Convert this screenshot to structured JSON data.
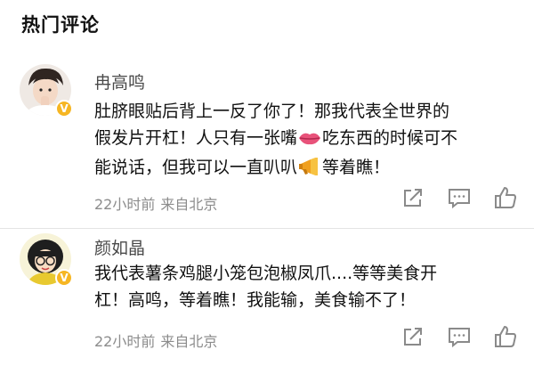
{
  "section": {
    "title": "热门评论"
  },
  "comments": [
    {
      "username": "冉高鸣",
      "line1": "肚脐眼贴后背上一反了你了！那我代表全世界的",
      "line2_a": "假发片开杠！人只有一张嘴",
      "line2_b": "吃东西的时候可不",
      "line3_a": "能说话，但我可以一直叭叭",
      "line3_b": "等着瞧！",
      "time": "22小时前",
      "location": "来自北京",
      "emojis": [
        "lips-emoji",
        "megaphone-emoji"
      ],
      "icons": [
        "share-icon",
        "comment-icon",
        "like-icon"
      ]
    },
    {
      "username": "颜如晶",
      "line1": "我代表薯条鸡腿小笼包泡椒凤爪....等等美食开",
      "line2": "杠！高鸣，等着瞧！我能输，美食输不了！",
      "time": "22小时前",
      "location": "来自北京",
      "icons": [
        "share-icon",
        "comment-icon",
        "like-icon"
      ]
    }
  ],
  "colors": {
    "text": "#111111",
    "meta": "#8c8c8c",
    "username": "#4a4a4a",
    "verified": "#f6b623"
  }
}
